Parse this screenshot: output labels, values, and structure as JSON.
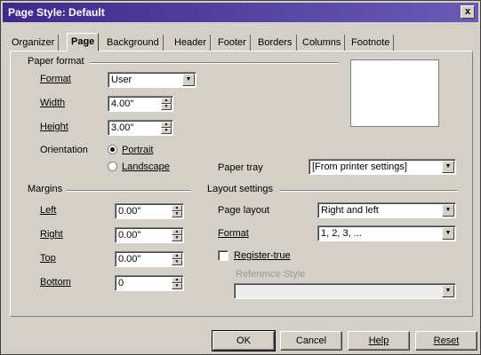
{
  "window": {
    "title": "Page Style: Default",
    "close_glyph": "x"
  },
  "tabs": [
    "Organizer",
    "Page",
    "Background",
    "Header",
    "Footer",
    "Borders",
    "Columns",
    "Footnote"
  ],
  "active_tab": "Page",
  "paper_format": {
    "group_label": "Paper format",
    "format_label": "Format",
    "format_value": "User",
    "width_label": "Width",
    "width_value": "4.00\"",
    "height_label": "Height",
    "height_value": "3.00\"",
    "orientation_label": "Orientation",
    "portrait_label": "Portrait",
    "landscape_label": "Landscape",
    "orientation_selected": "Portrait",
    "paper_tray_label": "Paper tray",
    "paper_tray_value": "[From printer settings]"
  },
  "margins": {
    "group_label": "Margins",
    "left_label": "Left",
    "left_value": "0.00\"",
    "right_label": "Right",
    "right_value": "0.00\"",
    "top_label": "Top",
    "top_value": "0.00\"",
    "bottom_label": "Bottom",
    "bottom_value": "0"
  },
  "layout": {
    "group_label": "Layout settings",
    "page_layout_label": "Page layout",
    "page_layout_value": "Right and left",
    "format_label": "Format",
    "format_value": "1, 2, 3, ...",
    "register_true_label": "Register-true",
    "register_true_checked": false,
    "reference_style_label": "Reference Style",
    "reference_style_value": ""
  },
  "buttons": {
    "ok": "OK",
    "cancel": "Cancel",
    "help": "Help",
    "reset": "Reset"
  },
  "colors": {
    "titlebar": "#3d2a8c",
    "face": "#d4d0c8"
  }
}
